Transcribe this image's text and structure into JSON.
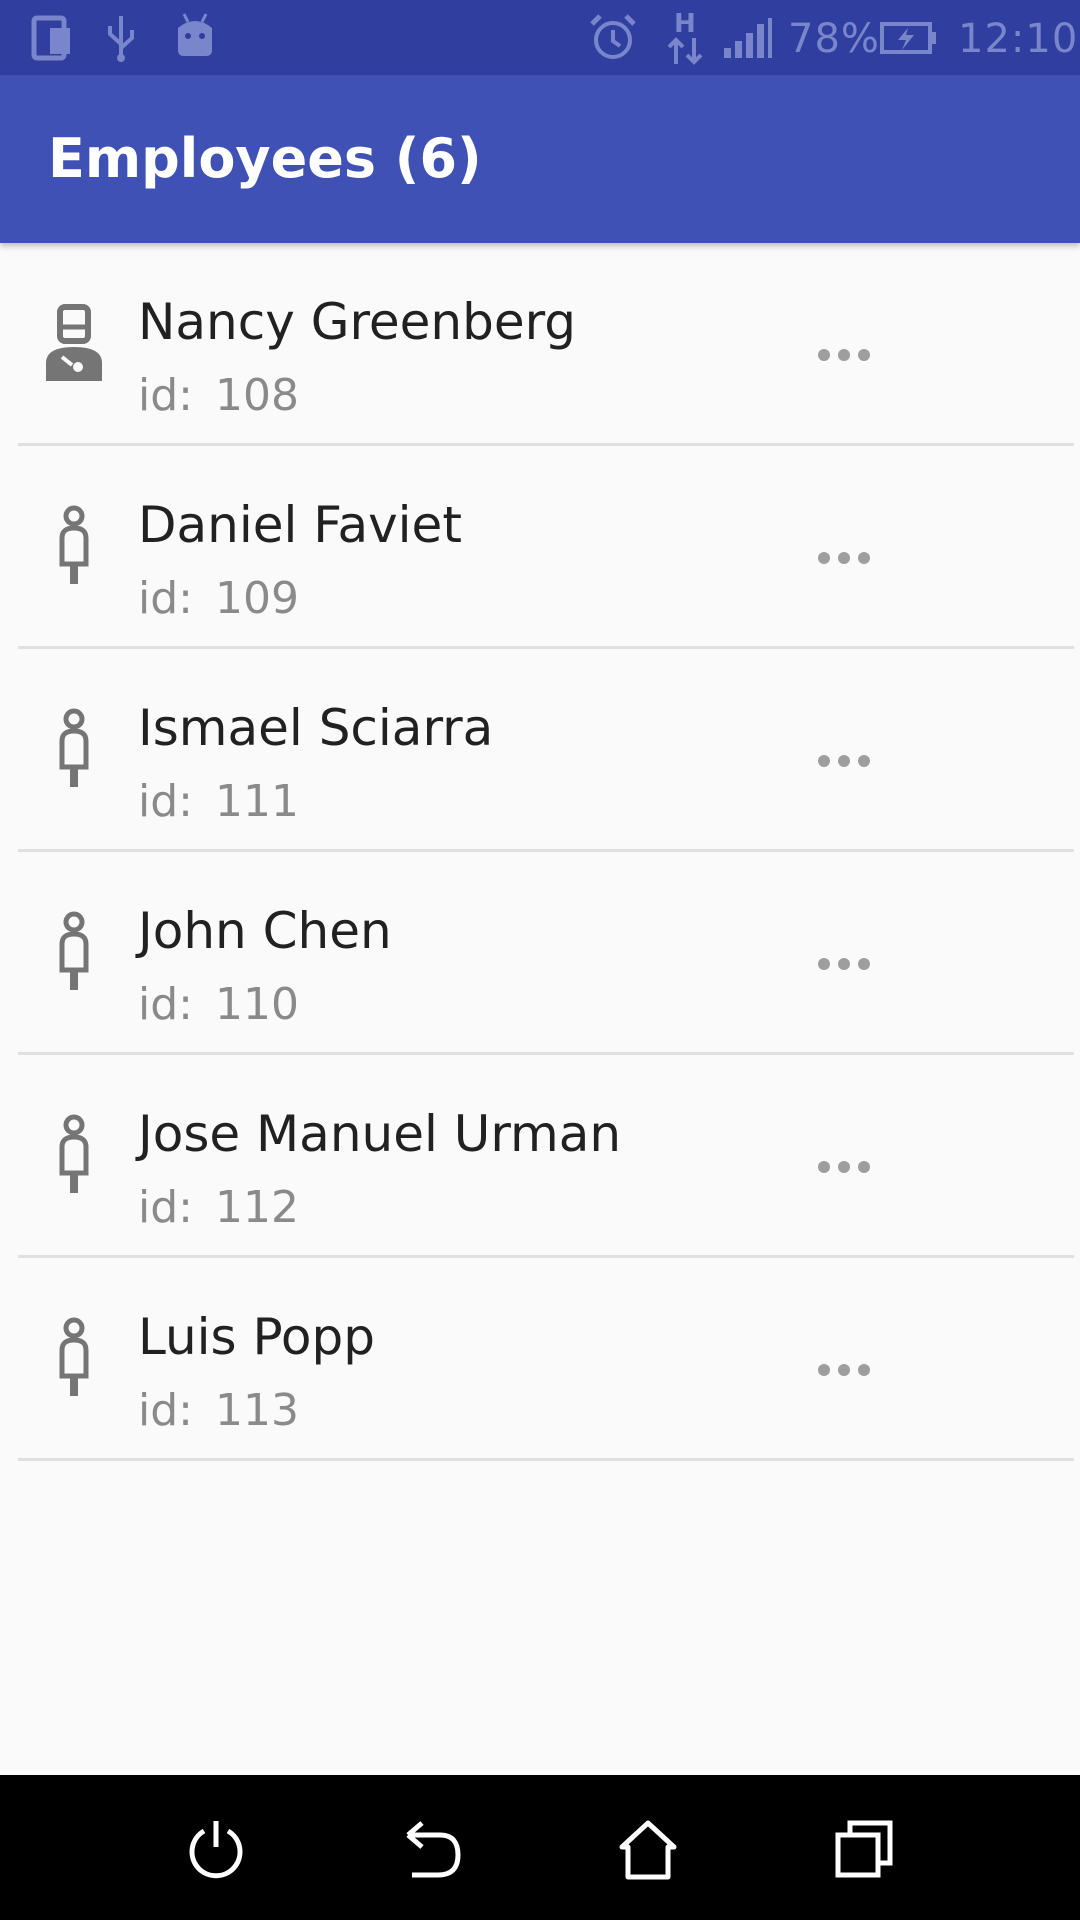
{
  "status_bar": {
    "battery_percent": "78%",
    "time": "12:10",
    "network_type": "H",
    "icons": [
      "notification-screen-icon",
      "usb-icon",
      "android-debug-icon",
      "alarm-icon",
      "network-h-icon",
      "signal-icon",
      "battery-charging-icon"
    ]
  },
  "app_bar": {
    "title": "Employees (6)"
  },
  "employees": [
    {
      "name": "Nancy Greenberg",
      "id_label": "id:",
      "id": "108",
      "icon": "manager-person-icon"
    },
    {
      "name": "Daniel Faviet",
      "id_label": "id:",
      "id": "109",
      "icon": "person-icon"
    },
    {
      "name": "Ismael Sciarra",
      "id_label": "id:",
      "id": "111",
      "icon": "person-icon"
    },
    {
      "name": "John Chen",
      "id_label": "id:",
      "id": "110",
      "icon": "person-icon"
    },
    {
      "name": "Jose Manuel Urman",
      "id_label": "id:",
      "id": "112",
      "icon": "person-icon"
    },
    {
      "name": "Luis Popp",
      "id_label": "id:",
      "id": "113",
      "icon": "person-icon"
    }
  ],
  "navigation_bar": {
    "buttons": [
      "power-icon",
      "back-icon",
      "home-icon",
      "recents-icon"
    ]
  },
  "colors": {
    "status_bar": "#303f9f",
    "app_bar": "#3f51b5",
    "background": "#fafafa",
    "divider": "#e0e0e0",
    "icon_gray": "#757575"
  }
}
